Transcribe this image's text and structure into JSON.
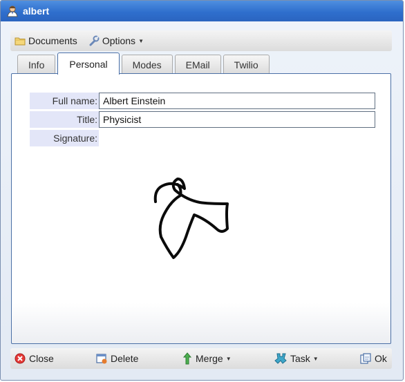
{
  "window": {
    "title": "albert",
    "icon": "user-icon"
  },
  "toolbar": {
    "documents_label": "Documents",
    "documents_icon": "folder-icon",
    "options_label": "Options",
    "options_icon": "wrench-icon"
  },
  "tabs": [
    {
      "label": "Info",
      "active": false
    },
    {
      "label": "Personal",
      "active": true
    },
    {
      "label": "Modes",
      "active": false
    },
    {
      "label": "EMail",
      "active": false
    },
    {
      "label": "Twilio",
      "active": false
    }
  ],
  "form": {
    "full_name_label": "Full name:",
    "full_name_value": "Albert Einstein",
    "title_label": "Title:",
    "title_value": "Physicist",
    "signature_label": "Signature:"
  },
  "footer": {
    "close_label": "Close",
    "delete_label": "Delete",
    "merge_label": "Merge",
    "task_label": "Task",
    "ok_label": "Ok"
  },
  "colors": {
    "titlebar": "#2f6fcd",
    "label_bg": "#e3e6f8",
    "panel_border": "#4a6fa5"
  }
}
